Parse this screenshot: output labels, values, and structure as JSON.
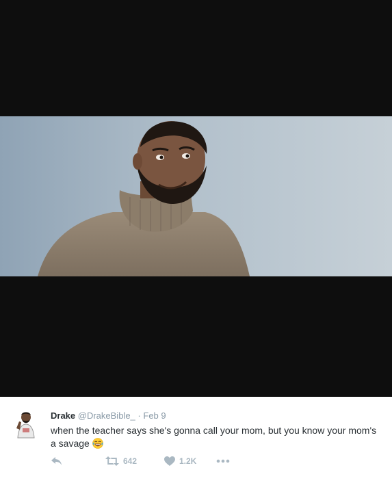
{
  "tweet": {
    "author_name": "Drake",
    "handle": "@DrakeBible_",
    "separator": "·",
    "date": "Feb 9",
    "text": "when the teacher says she's gonna call your mom, but you know your mom's a savage",
    "emoji_icon": "tears-of-joy-emoji-icon"
  },
  "actions": {
    "reply_icon": "reply-icon",
    "retweet_icon": "retweet-icon",
    "retweet_count": "642",
    "like_icon": "heart-icon",
    "like_count": "1.2K",
    "more_icon": "more-dots-icon"
  },
  "colors": {
    "media_background": "#0e0e0e",
    "text_primary": "#292f33",
    "text_secondary": "#8899a6",
    "action_gray": "#aab8c2"
  }
}
